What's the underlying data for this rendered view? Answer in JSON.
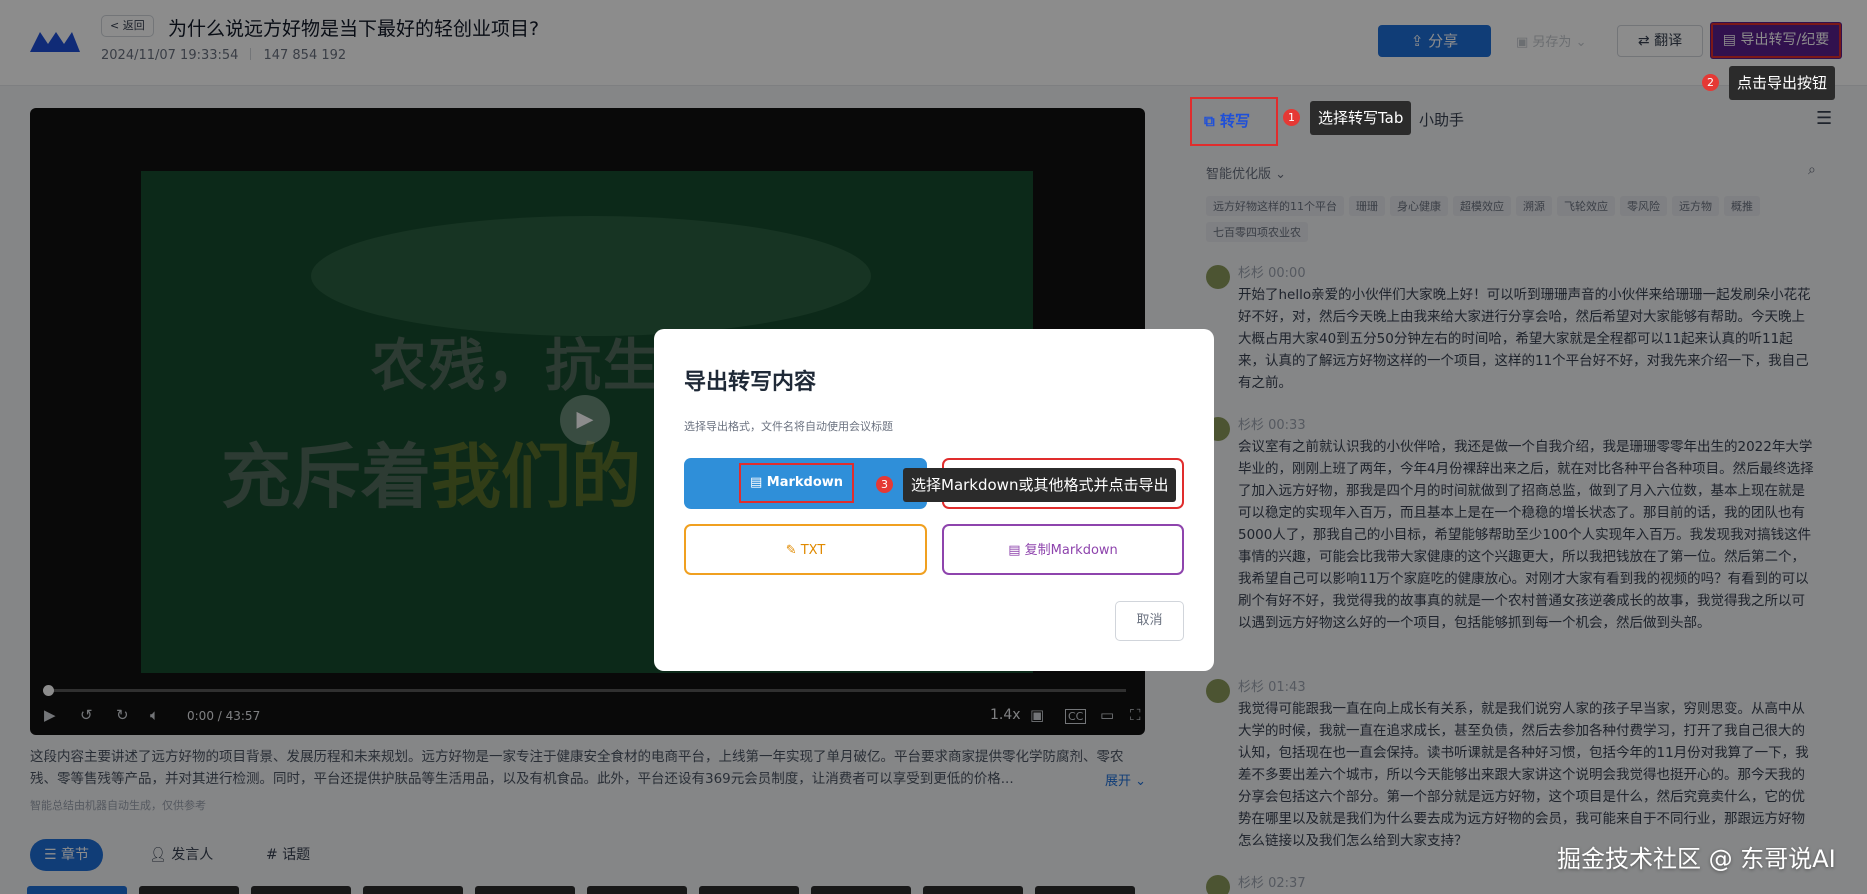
{
  "header": {
    "back_label": "< 返回",
    "title": "为什么说远方好物是当下最好的轻创业项目?",
    "datetime": "2024/11/07 19:33:54",
    "id_number": "147 854 192",
    "share_label": "分享",
    "saveas_label": "另存为",
    "translate_label": "翻译",
    "export_label": "导出转写/纪要"
  },
  "hints": {
    "step1_num": "1",
    "step1_text": "选择转写Tab",
    "step2_num": "2",
    "step2_text": "点击导出按钮",
    "step3_num": "3",
    "step3_text": "选择Markdown或其他格式并点击导出"
  },
  "video": {
    "frame_line1": "农残，抗生素，激素",
    "frame_line2a": "充斥着",
    "frame_line2b": "我们的",
    "time": "0:00 / 43:57",
    "speed": "1.4x",
    "cc": "CC"
  },
  "summary": {
    "text": "这段内容主要讲述了远方好物的项目背景、发展历程和未来规划。远方好物是一家专注于健康安全食材的电商平台，上线第一年实现了单月破亿。平台要求商家提供零化学防腐剂、零农残、零等售残等产品，并对其进行检测。同时，平台还提供护肤品等生活用品，以及有机食品。此外，平台还设有369元会员制度，让消费者可以享受到更低的价格...",
    "expand_label": "展开",
    "ai_note": "智能总结由机器自动生成，仅供参考"
  },
  "bottom_tabs": [
    "章节",
    "发言人",
    "话题"
  ],
  "right_panel": {
    "tab_transcribe": "转写",
    "tab_assistant": "小助手",
    "smart_version": "智能优化版",
    "keywords": [
      "远方好物这样的11个平台",
      "珊珊",
      "身心健康",
      "超模效应",
      "溯源",
      "飞轮效应",
      "零风险",
      "远方物",
      "概推",
      "七百零四项农业农"
    ],
    "segments": [
      {
        "speaker": "杉杉 00:00",
        "text": "开始了hello亲爱的小伙伴们大家晚上好！可以听到珊珊声音的小伙伴来给珊珊一起发刷朵小花花好不好，对，然后今天晚上由我来给大家进行分享会哈，然后希望对大家能够有帮助。今天晚上大概占用大家40到五分50分钟左右的时间哈，希望大家就是全程都可以11起来认真的听11起来，认真的了解远方好物这样的一个项目，这样的11个平台好不好，对我先来介绍一下，我自己有之前。"
      },
      {
        "speaker": "杉杉 00:33",
        "text": "会议室有之前就认识我的小伙伴哈，我还是做一个自我介绍，我是珊珊零零年出生的2022年大学毕业的，刚刚上班了两年，今年4月份裸辞出来之后，就在对比各种平台各种项目。然后最终选择了加入远方好物，那我是四个月的时间就做到了招商总监，做到了月入六位数，基本上现在就是可以稳定的实现年入百万，而且基本上是在一个稳稳的增长状态了。那目前的话，我的团队也有5000人了，那我自己的小目标，希望能够帮助至少100个人实现年入百万。我发现我对搞钱这件事情的兴趣，可能会比我带大家健康的这个兴趣更大，所以我把钱放在了第一位。然后第二个，我希望自己可以影响11万个家庭吃的健康放心。对刚才大家有看到我的视频的吗？有看到的可以刷个有好不好，我觉得我的故事真的就是一个农村普通女孩逆袭成长的故事，我觉得我之所以可以遇到远方好物这么好的一个项目，包括能够抓到每一个机会，然后做到头部。"
      },
      {
        "speaker": "杉杉 01:43",
        "text": "我觉得可能跟我一直在向上成长有关系，就是我们说穷人家的孩子早当家，穷则思变。从高中从大学的时候，我就一直在追求成长，甚至负债，然后去参加各种付费学习，打开了我自己很大的认知，包括现在也一直会保持。读书听课就是各种好习惯，包括今年的11月份对我算了一下，我差不多要出差六个城市，所以今天能够出来跟大家讲这个说明会我觉得也挺开心的。那今天我的分享会包括这六个部分。第一个部分就是远方好物，这个项目是什么，然后究竟卖什么，它的优势在哪里以及就是我们为什么要去成为远方好物的会员，我可能来自于不同行业，那跟远方好物怎么链接以及我们怎么给到大家支持？"
      },
      {
        "speaker": "杉杉 02:37",
        "text": ""
      }
    ]
  },
  "dialog": {
    "title": "导出转写内容",
    "subtitle": "选择导出格式，文件名将自动使用会议标题",
    "btn_markdown": "Markdown",
    "btn_html": "",
    "btn_txt": "TXT",
    "btn_copy_markdown": "复制Markdown",
    "cancel": "取消"
  },
  "watermark": "掘金技术社区 @ 东哥说AI",
  "colors": {
    "primary": "#1e6fd9",
    "export_button": "#5a1f8f",
    "highlight_red": "#e02d2d",
    "txt_orange": "#f0a020",
    "copy_purple": "#8e44ad"
  }
}
